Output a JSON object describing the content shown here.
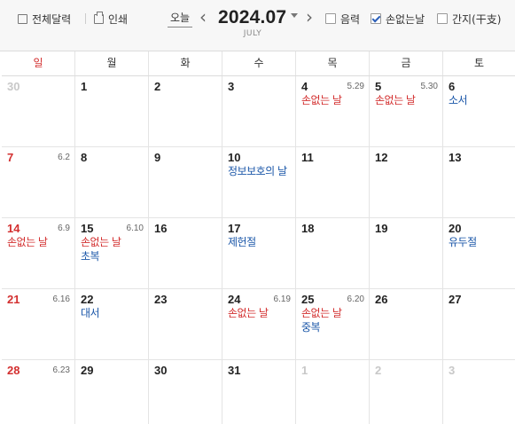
{
  "toolbar": {
    "full_calendar_label": "전체달력",
    "print_label": "인쇄",
    "today_label": "오늘",
    "prev_arrow": "‹",
    "next_arrow": "›",
    "month_title": "2024.07",
    "month_english": "JULY",
    "options": [
      {
        "label": "음력",
        "checked": false
      },
      {
        "label": "손없는날",
        "checked": true
      },
      {
        "label": "간지(干支)",
        "checked": false
      }
    ]
  },
  "calendar": {
    "weekdays": [
      "일",
      "월",
      "화",
      "수",
      "목",
      "금",
      "토"
    ],
    "weeks": [
      [
        {
          "day": "30",
          "other": true
        },
        {
          "day": "1"
        },
        {
          "day": "2"
        },
        {
          "day": "3"
        },
        {
          "day": "4",
          "lunar": "5.29",
          "events": [
            {
              "text": "손없는 날",
              "color": "red"
            }
          ]
        },
        {
          "day": "5",
          "lunar": "5.30",
          "events": [
            {
              "text": "손없는 날",
              "color": "red"
            }
          ]
        },
        {
          "day": "6",
          "events": [
            {
              "text": "소서",
              "color": "blue"
            }
          ]
        }
      ],
      [
        {
          "day": "7",
          "lunar": "6.2"
        },
        {
          "day": "8"
        },
        {
          "day": "9"
        },
        {
          "day": "10",
          "events": [
            {
              "text": "정보보호의 날",
              "color": "blue"
            }
          ]
        },
        {
          "day": "11"
        },
        {
          "day": "12"
        },
        {
          "day": "13"
        }
      ],
      [
        {
          "day": "14",
          "lunar": "6.9",
          "events": [
            {
              "text": "손없는 날",
              "color": "red"
            }
          ]
        },
        {
          "day": "15",
          "lunar": "6.10",
          "events": [
            {
              "text": "손없는 날",
              "color": "red"
            },
            {
              "text": "초복",
              "color": "blue"
            }
          ]
        },
        {
          "day": "16"
        },
        {
          "day": "17",
          "events": [
            {
              "text": "제헌절",
              "color": "blue"
            }
          ]
        },
        {
          "day": "18"
        },
        {
          "day": "19"
        },
        {
          "day": "20",
          "events": [
            {
              "text": "유두절",
              "color": "blue"
            }
          ]
        }
      ],
      [
        {
          "day": "21",
          "lunar": "6.16"
        },
        {
          "day": "22",
          "events": [
            {
              "text": "대서",
              "color": "blue"
            }
          ]
        },
        {
          "day": "23"
        },
        {
          "day": "24",
          "lunar": "6.19",
          "events": [
            {
              "text": "손없는 날",
              "color": "red"
            }
          ]
        },
        {
          "day": "25",
          "lunar": "6.20",
          "events": [
            {
              "text": "손없는 날",
              "color": "red"
            },
            {
              "text": "중복",
              "color": "blue"
            }
          ]
        },
        {
          "day": "26"
        },
        {
          "day": "27"
        }
      ],
      [
        {
          "day": "28",
          "lunar": "6.23"
        },
        {
          "day": "29"
        },
        {
          "day": "30"
        },
        {
          "day": "31"
        },
        {
          "day": "1",
          "other": true
        },
        {
          "day": "2",
          "other": true
        },
        {
          "day": "3",
          "other": true
        }
      ]
    ]
  },
  "colors": {
    "sunday": "#d32f2f",
    "event_red": "#d32f2f",
    "event_blue": "#1a56a8",
    "other_month": "#c8c8c8"
  }
}
